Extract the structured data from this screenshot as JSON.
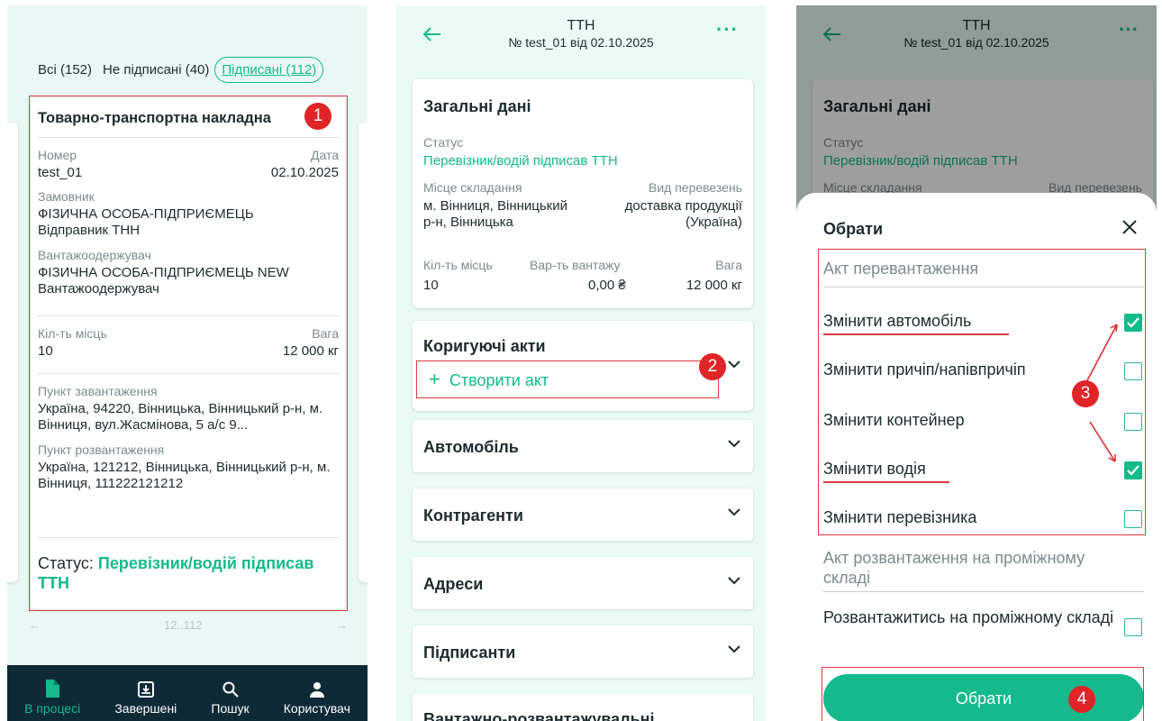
{
  "panel1": {
    "tabs": [
      "Всі (152)",
      "Не підписані (40)",
      "Підписані (112)"
    ],
    "card": {
      "title": "Товарно-транспортна накладна",
      "number_label": "Номер",
      "number": "test_01",
      "date_label": "Дата",
      "date": "02.10.2025",
      "customer_label": "Замовник",
      "customer": "ФІЗИЧНА ОСОБА-ПІДПРИЄМЕЦЬ Відправник ТНН",
      "consignee_label": "Вантажоодержувач",
      "consignee": "ФІЗИЧНА ОСОБА-ПІДПРИЄМЕЦЬ NEW Вантажоодержувач",
      "places_label": "Кіл-ть місць",
      "places": "10",
      "weight_label": "Вага",
      "weight": "12 000 кг",
      "load_label": "Пункт завантаження",
      "load": "Україна, 94220, Вінницька, Вінницький р-н, м. Вінниця, вул.Жасмінова, 5 а/с 9...",
      "unload_label": "Пункт розвантаження",
      "unload": "Україна, 121212, Вінницька, Вінницький р-н, м. Вінниця, 111222121212",
      "status_label": "Статус:",
      "status": "Перевізник/водій підписав ТТН"
    },
    "pager": "12..112",
    "nav": [
      "В процесі",
      "Завершені",
      "Пошук",
      "Користувач"
    ],
    "badge": "1"
  },
  "header": {
    "title": "ТТН",
    "subtitle": "№ test_01 від 02.10.2025"
  },
  "panel2": {
    "general": {
      "title": "Загальні дані",
      "status_label": "Статус",
      "status": "Перевізник/водій підписав ТТН",
      "place_label": "Місце складання",
      "place": "м. Вінниця, Вінницький р-н, Вінницька",
      "transport_label": "Вид перевезень",
      "transport": "доставка продукції (Україна)",
      "places_label": "Кіл-ть місць",
      "places": "10",
      "value_label": "Вар-ть вантажу",
      "value": "0,00 ₴",
      "weight_label": "Вага",
      "weight": "12 000 кг"
    },
    "corr_title": "Коригуючі акти",
    "create_act": "Створити акт",
    "sections": [
      "Автомобіль",
      "Контрагенти",
      "Адреси",
      "Підписанти",
      "Вантажно-розвантажувальні"
    ],
    "badge": "2"
  },
  "panel3": {
    "sheet_title": "Обрати",
    "group1": "Акт перевантаження",
    "options": [
      {
        "label": "Змінити автомобіль",
        "checked": true
      },
      {
        "label": "Змінити причіп/напівпричіп",
        "checked": false
      },
      {
        "label": "Змінити контейнер",
        "checked": false
      },
      {
        "label": "Змінити водія",
        "checked": true
      },
      {
        "label": "Змінити перевізника",
        "checked": false
      }
    ],
    "group2": "Акт розвантаження на проміжному складі",
    "option_last": "Розвантажитись на проміжному складі",
    "button": "Обрати",
    "badge3": "3",
    "badge4": "4"
  },
  "colors": {
    "accent": "#14b98c",
    "marker": "#e02427",
    "nav": "#0e2a37"
  }
}
